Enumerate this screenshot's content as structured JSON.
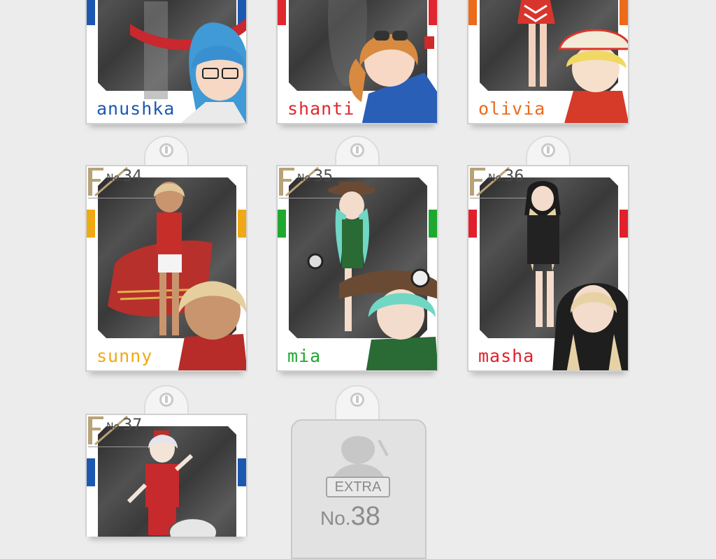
{
  "cards": [
    {
      "name": "anushka",
      "number": "",
      "color": "#1c58b0"
    },
    {
      "name": "shanti",
      "number": "",
      "color": "#e0262e"
    },
    {
      "name": "olivia",
      "number": "",
      "color": "#ec6a1a"
    },
    {
      "name": "sunny",
      "number": "34",
      "color": "#f0a914"
    },
    {
      "name": "mia",
      "number": "35",
      "color": "#1fa82f"
    },
    {
      "name": "masha",
      "number": "36",
      "color": "#e0202a"
    },
    {
      "name": "",
      "number": "37",
      "color": "#1c58b0"
    }
  ],
  "no_label": "No.",
  "extra": {
    "badge": "EXTRA",
    "no_label": "No.",
    "number": "38"
  }
}
